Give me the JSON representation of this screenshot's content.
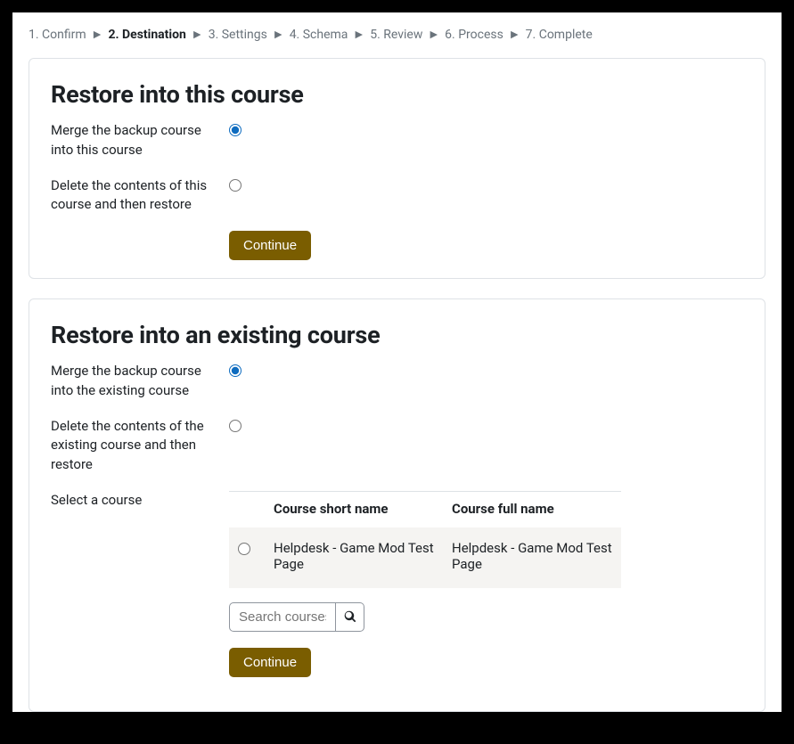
{
  "stepper": {
    "steps": [
      "1. Confirm",
      "2. Destination",
      "3. Settings",
      "4. Schema",
      "5. Review",
      "6. Process",
      "7. Complete"
    ],
    "active_index": 1
  },
  "section_this": {
    "heading": "Restore into this course",
    "merge_label": "Merge the backup course into this course",
    "delete_label": "Delete the contents of this course and then restore",
    "continue_label": "Continue"
  },
  "section_existing": {
    "heading": "Restore into an existing course",
    "merge_label": "Merge the backup course into the existing course",
    "delete_label": "Delete the contents of the existing course and then restore",
    "select_label": "Select a course",
    "table": {
      "col_shortname": "Course short name",
      "col_fullname": "Course full name",
      "rows": [
        {
          "shortname": "Helpdesk - Game Mod Test Page",
          "fullname": "Helpdesk - Game Mod Test Page"
        }
      ]
    },
    "search_placeholder": "Search courses",
    "continue_label": "Continue"
  }
}
